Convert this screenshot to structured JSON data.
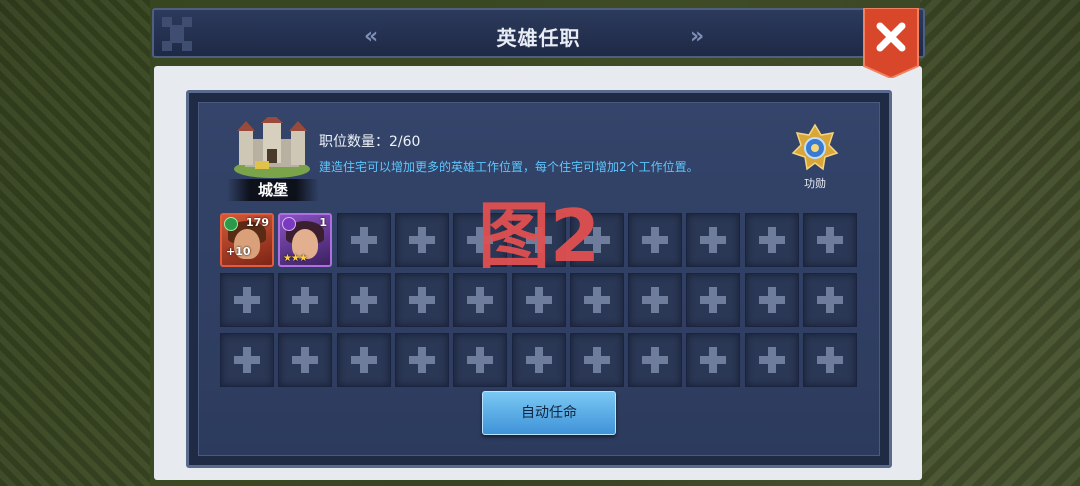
{
  "window": {
    "title": "英雄任职",
    "nav_prev": "«",
    "nav_next": "»"
  },
  "castle": {
    "label": "城堡"
  },
  "positions": {
    "count_label": "职位数量：2/60",
    "description": "建造住宅可以增加更多的英雄工作位置，每个住宅可增加2个工作位置。"
  },
  "merit": {
    "label": "功勋"
  },
  "heroes": [
    {
      "level": "179",
      "bonus": "+10",
      "stars": "",
      "rarity_color": "#e25b3a"
    },
    {
      "level": "1",
      "bonus": "",
      "stars": "★★★",
      "rarity_color": "#b06ee0"
    }
  ],
  "grid": {
    "rows": 3,
    "cols": 11,
    "filled": 2
  },
  "auto_button": {
    "label": "自动任命"
  },
  "watermark": "图2",
  "colors": {
    "accent": "#5cc7ff",
    "close_button": "#e04a2b",
    "watermark": "#e05050"
  }
}
